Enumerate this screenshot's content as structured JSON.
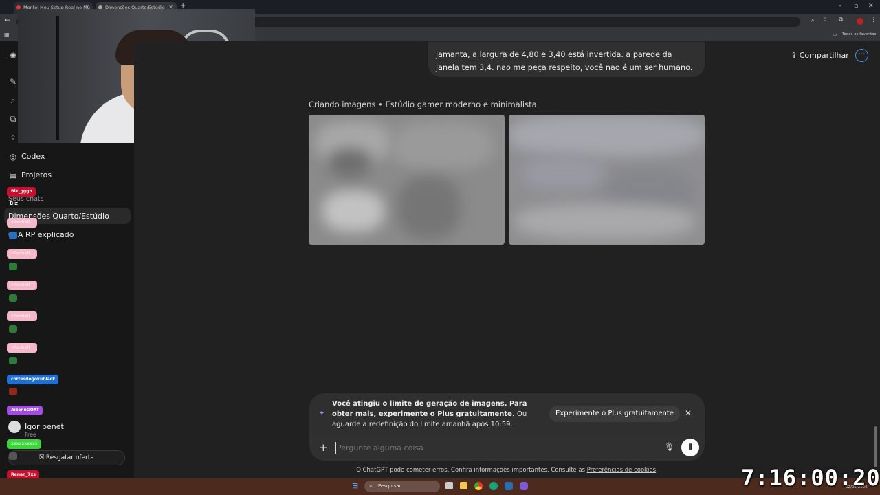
{
  "browser": {
    "tabs": [
      {
        "title": "Montei Meu Setup Real no Mu"
      },
      {
        "title": "Dimensões Quarto/Estúdio"
      }
    ],
    "bookmarks_label": "Todos os favoritos"
  },
  "sidebar": {
    "codex_label": "Codex",
    "projects_label": "Projetos",
    "chats_header": "Seus chats",
    "chats": [
      {
        "label": "Dimensões Quarto/Estúdio",
        "active": true
      },
      {
        "label": "GTA RP explicado",
        "active": false
      }
    ],
    "user_name": "Igor benet",
    "user_plan": "Free",
    "offer_label": "Resgatar oferta"
  },
  "chat_overlay": {
    "usernames": [
      "Blk_gggh",
      "Biz",
      "vllorbell",
      "vllorbell",
      "vllorbell",
      "vllorbell",
      "vllorbell",
      "cortesdogokublack",
      "AizennGOAT",
      "xxxxxxxxxx",
      "Renan_7xs"
    ]
  },
  "header": {
    "share_label": "Compartilhar",
    "more_icon": "···"
  },
  "conversation": {
    "user_message": "jamanta, a largura de 4,80 e 3,40 está invertida. a parede da janela tem 3,4. nao me peça respeito, você nao é um ser humano.",
    "images_status": "Criando imagens • Estúdio gamer moderno e minimalista"
  },
  "limit_notice": {
    "bold_text": "Você atingiu o limite de geração de imagens. Para obter mais, experimente o Plus gratuitamente.",
    "normal_text": " Ou aguarde a redefinição do limite amanhã após 10:59.",
    "cta_label": "Experimente o Plus gratuitamente"
  },
  "composer": {
    "placeholder": "Pergunte alguma coisa"
  },
  "footer": {
    "disclaimer": "O ChatGPT pode cometer erros. Confira informações importantes. Consulte as ",
    "cookie_link": "Preferências de cookies",
    "period": "."
  },
  "overlay_clock": "7:16:00:20",
  "taskbar": {
    "search_label": "Pesquisar",
    "date": "02/03/2026"
  },
  "colors": {
    "main_bg": "#212121",
    "sidebar_bg": "#171717",
    "bubble_bg": "#303030",
    "accent": "#4a90e2"
  }
}
